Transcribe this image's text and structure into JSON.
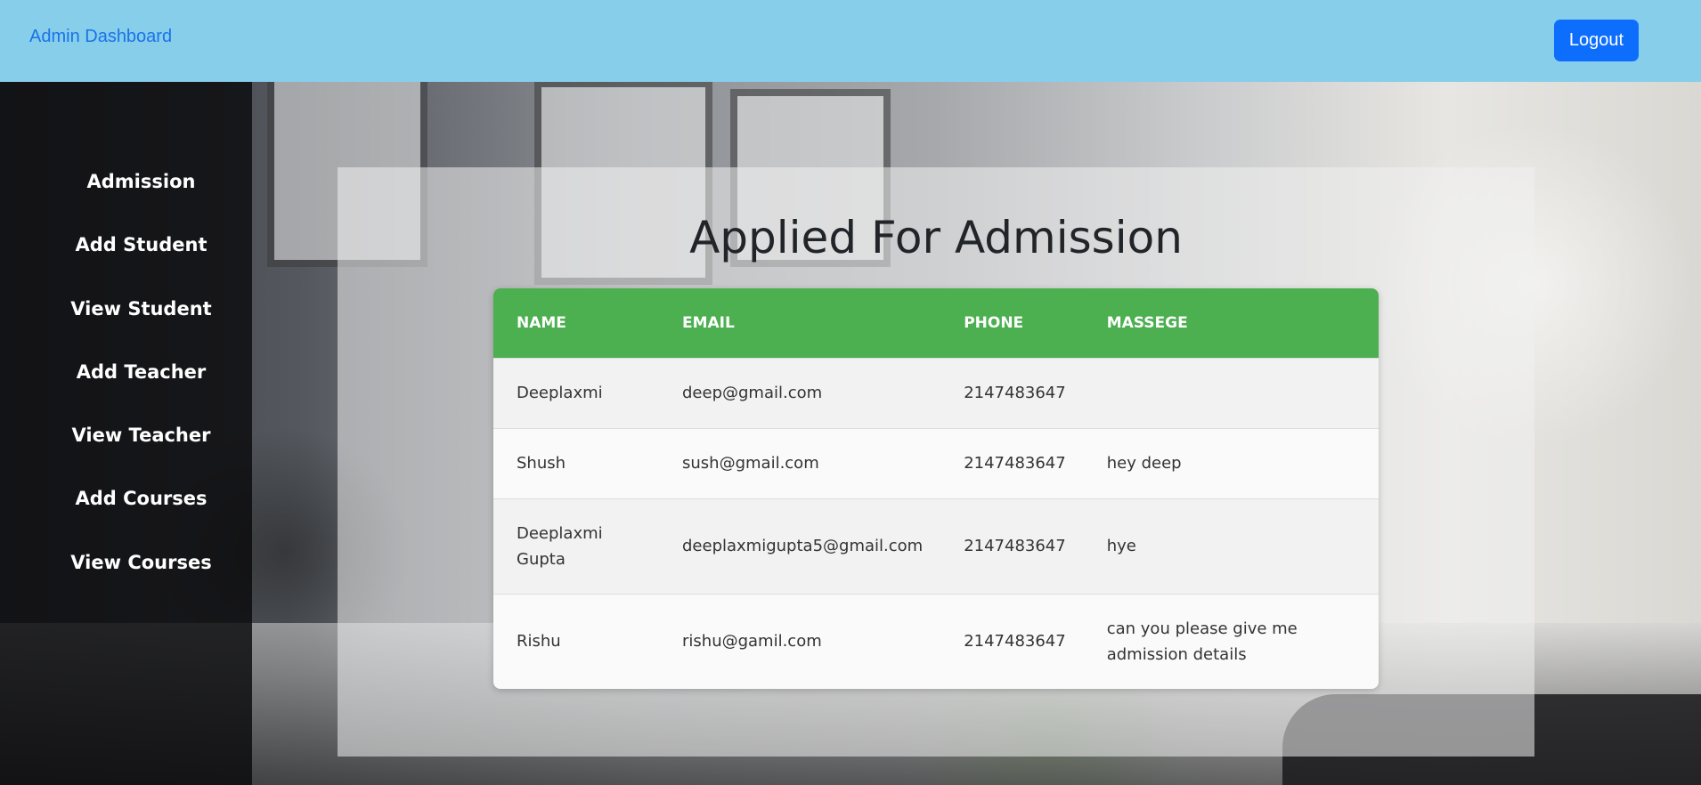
{
  "navbar": {
    "brand": "Admin Dashboard",
    "logout_label": "Logout"
  },
  "sidebar": {
    "items": [
      {
        "label": "Admission"
      },
      {
        "label": "Add Student"
      },
      {
        "label": "View Student"
      },
      {
        "label": "Add Teacher"
      },
      {
        "label": "View Teacher"
      },
      {
        "label": "Add Courses"
      },
      {
        "label": "View Courses"
      }
    ]
  },
  "main": {
    "title": "Applied For Admission",
    "table": {
      "headers": [
        "NAME",
        "EMAIL",
        "PHONE",
        "MASSEGE"
      ],
      "rows": [
        {
          "name": "Deeplaxmi",
          "email": "deep@gmail.com",
          "phone": "2147483647",
          "message": ""
        },
        {
          "name": "Shush",
          "email": "sush@gmail.com",
          "phone": "2147483647",
          "message": "hey deep"
        },
        {
          "name": "Deeplaxmi Gupta",
          "email": "deeplaxmigupta5@gmail.com",
          "phone": "2147483647",
          "message": "hye"
        },
        {
          "name": "Rishu",
          "email": "rishu@gamil.com",
          "phone": "2147483647",
          "message": "can you please give me admission details"
        }
      ]
    }
  },
  "colors": {
    "navbar_bg": "#87ceeb",
    "brand": "#1a73e8",
    "logout_bg": "#0d6efd",
    "table_header": "#4caf50",
    "sidebar_bg": "#0a0a0c"
  }
}
